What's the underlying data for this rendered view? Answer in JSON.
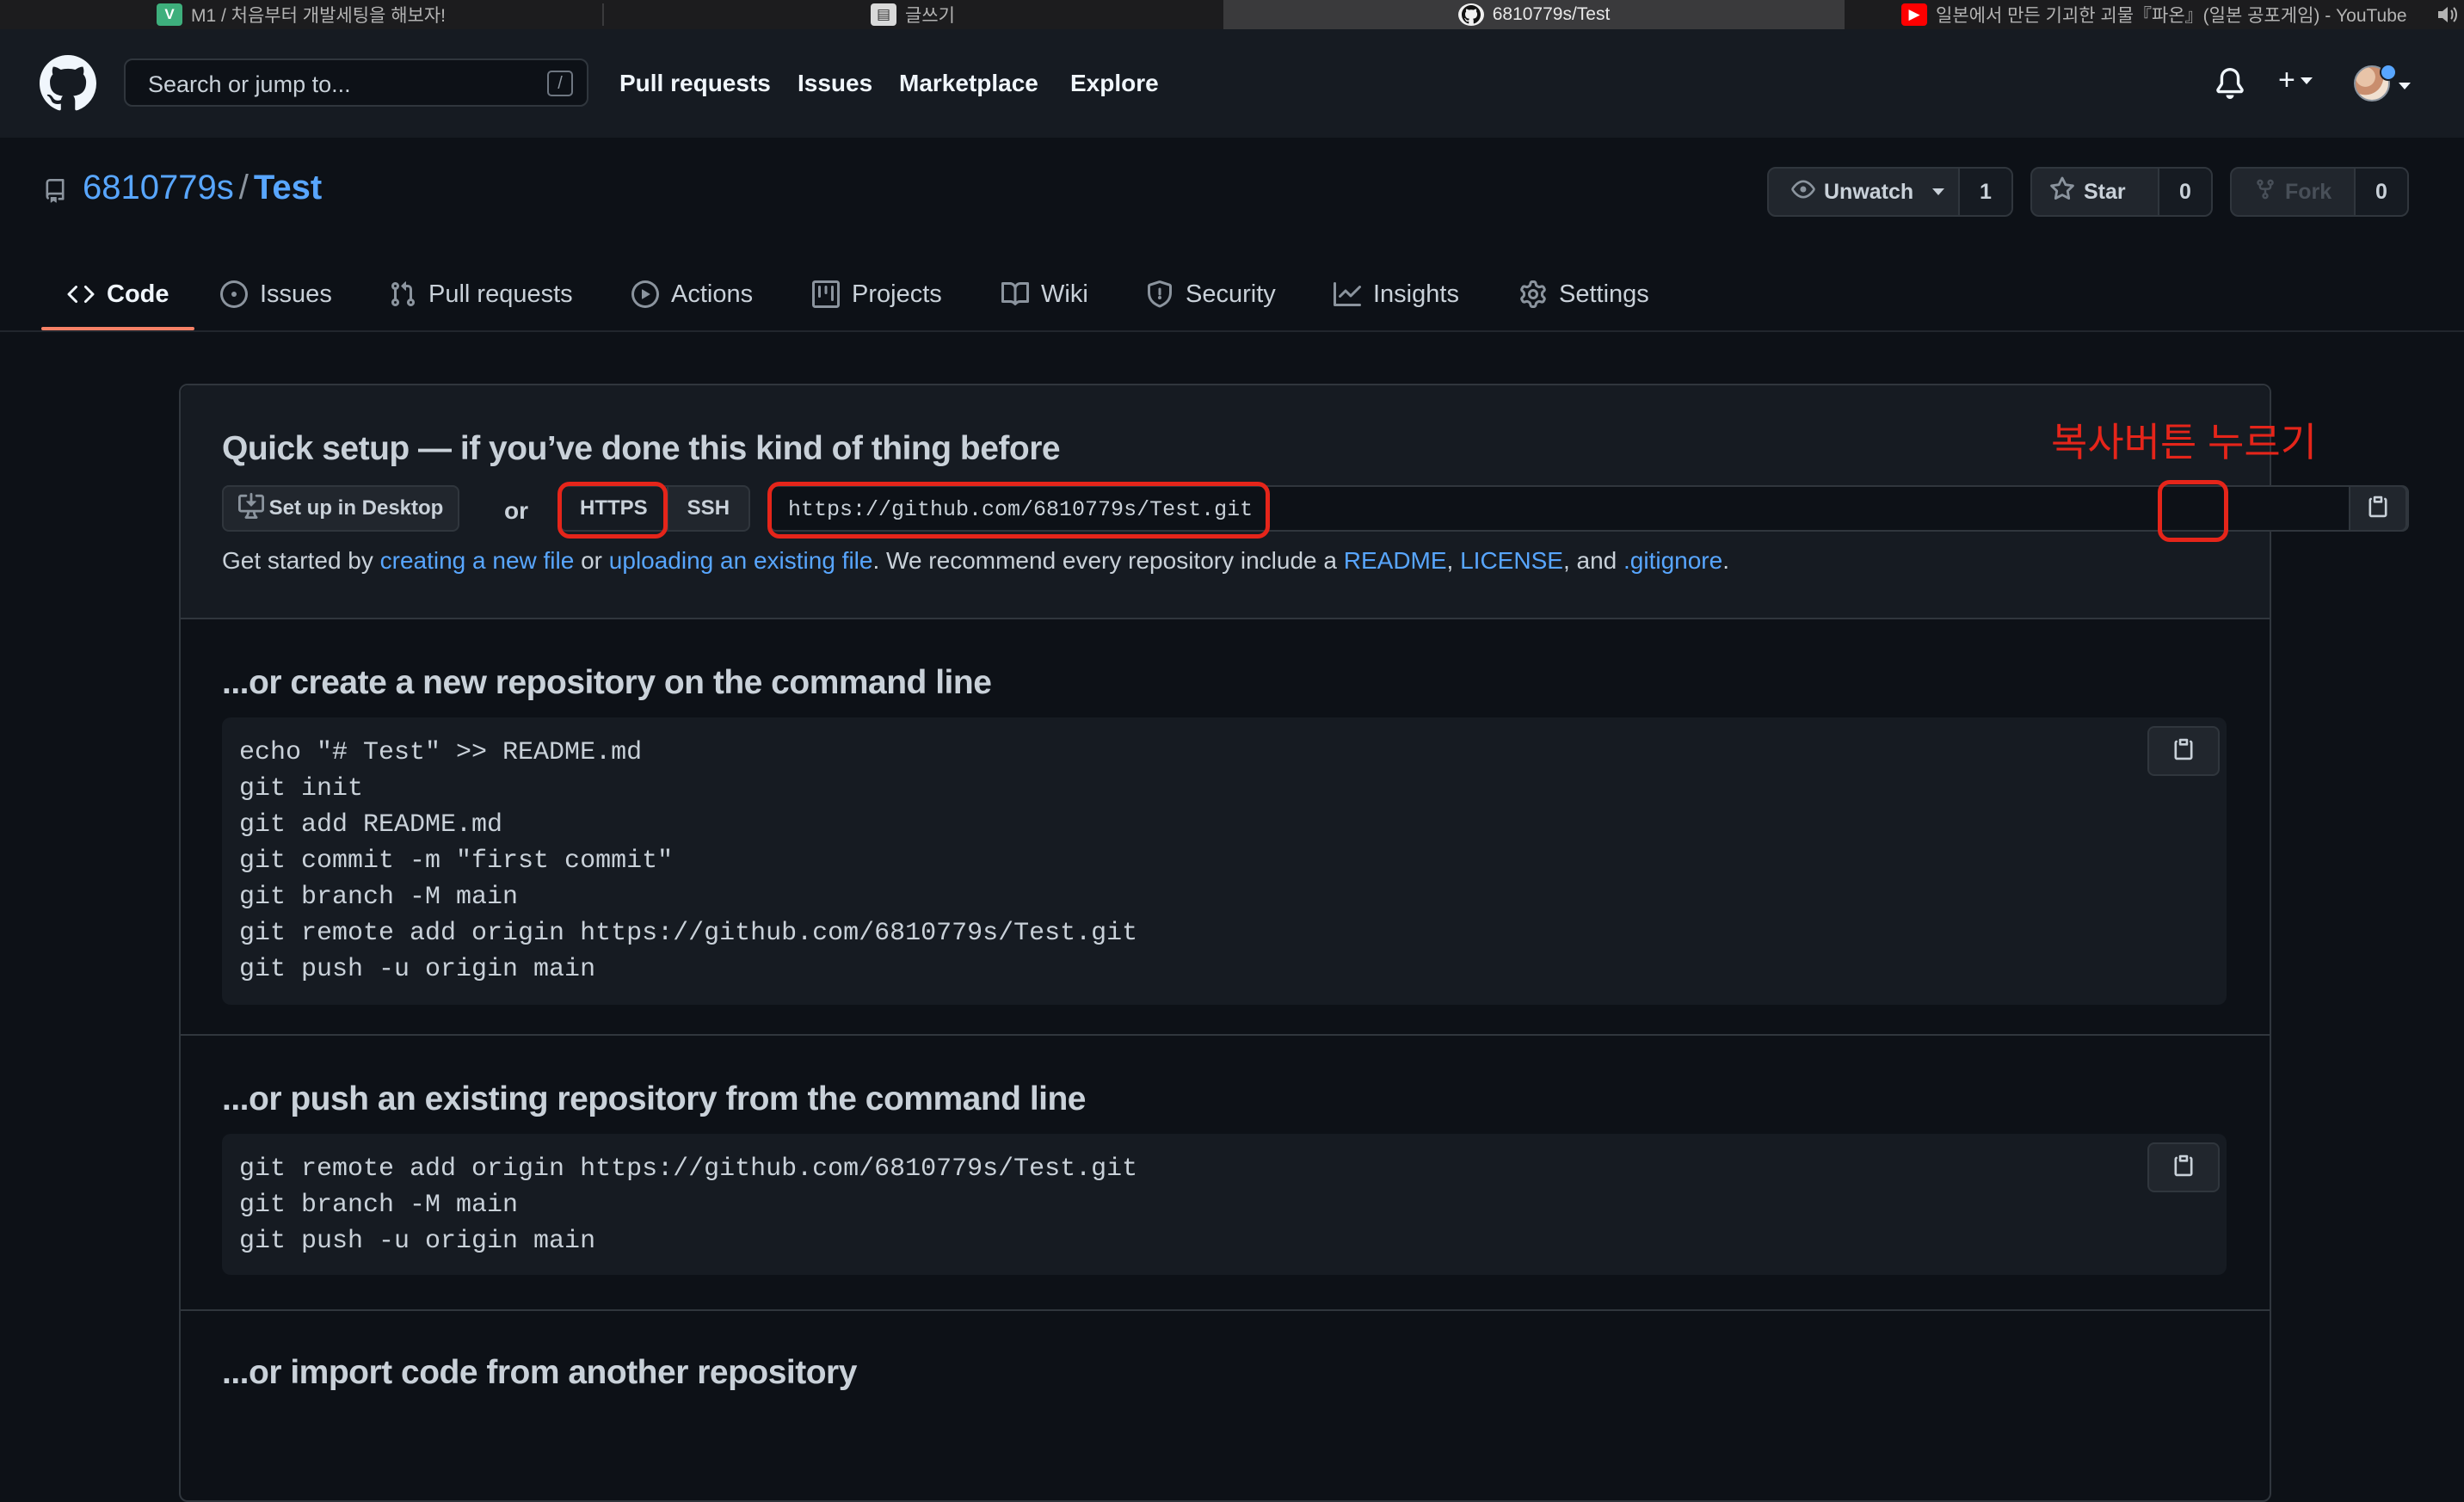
{
  "browser": {
    "tabs": [
      {
        "favicon": "V",
        "label": "M1 / 처음부터 개발세팅을 해보자!"
      },
      {
        "favicon": "note",
        "label": "글쓰기"
      },
      {
        "favicon": "github",
        "label": "6810779s/Test"
      },
      {
        "favicon": "youtube",
        "label": "일본에서 만든 기괴한 괴물『파온』(일본 공포게임) - YouTube"
      }
    ],
    "active_tab_index": 2,
    "speaker_icon": "speaker-icon"
  },
  "header": {
    "search_placeholder": "Search or jump to...",
    "search_shortcut": "/",
    "nav": [
      "Pull requests",
      "Issues",
      "Marketplace",
      "Explore"
    ],
    "plus_label": "+"
  },
  "repo": {
    "owner": "6810779s",
    "separator": "/",
    "name": "Test",
    "unwatch_label": "Unwatch",
    "unwatch_count": "1",
    "star_label": "Star",
    "star_count": "0",
    "fork_label": "Fork",
    "fork_count": "0"
  },
  "tabs": [
    {
      "label": "Code",
      "icon": "code-icon",
      "selected": true
    },
    {
      "label": "Issues",
      "icon": "issue-icon"
    },
    {
      "label": "Pull requests",
      "icon": "pull-request-icon"
    },
    {
      "label": "Actions",
      "icon": "play-icon"
    },
    {
      "label": "Projects",
      "icon": "project-icon"
    },
    {
      "label": "Wiki",
      "icon": "book-icon"
    },
    {
      "label": "Security",
      "icon": "shield-icon"
    },
    {
      "label": "Insights",
      "icon": "graph-icon"
    },
    {
      "label": "Settings",
      "icon": "gear-icon"
    }
  ],
  "quick_setup": {
    "title": "Quick setup — if you’ve done this kind of thing before",
    "desktop_button": "Set up in Desktop",
    "or_text": "or",
    "protocols": [
      "HTTPS",
      "SSH"
    ],
    "selected_protocol": "HTTPS",
    "clone_url": "https://github.com/6810779s/Test.git",
    "help": {
      "prefix": "Get started by ",
      "link1": "creating a new file",
      "mid1": " or ",
      "link2": "uploading an existing file",
      "mid2": ". We recommend every repository include a ",
      "link3": "README",
      "sep1": ", ",
      "link4": "LICENSE",
      "sep2": ", and ",
      "link5": ".gitignore",
      "suffix": "."
    }
  },
  "new_repo": {
    "title": "...or create a new repository on the command line",
    "code": "echo \"# Test\" >> README.md\ngit init\ngit add README.md\ngit commit -m \"first commit\"\ngit branch -M main\ngit remote add origin https://github.com/6810779s/Test.git\ngit push -u origin main"
  },
  "push_existing": {
    "title": "...or push an existing repository from the command line",
    "code": "git remote add origin https://github.com/6810779s/Test.git\ngit branch -M main\ngit push -u origin main"
  },
  "import_repo": {
    "title": "...or import code from another repository"
  },
  "annotation": {
    "note": "복사버튼 누르기",
    "color": "#e5251a"
  },
  "colors": {
    "background": "#0d1117",
    "header": "#161b22",
    "link": "#58a6ff",
    "tab_underline": "#f78166",
    "border": "#30363d"
  }
}
